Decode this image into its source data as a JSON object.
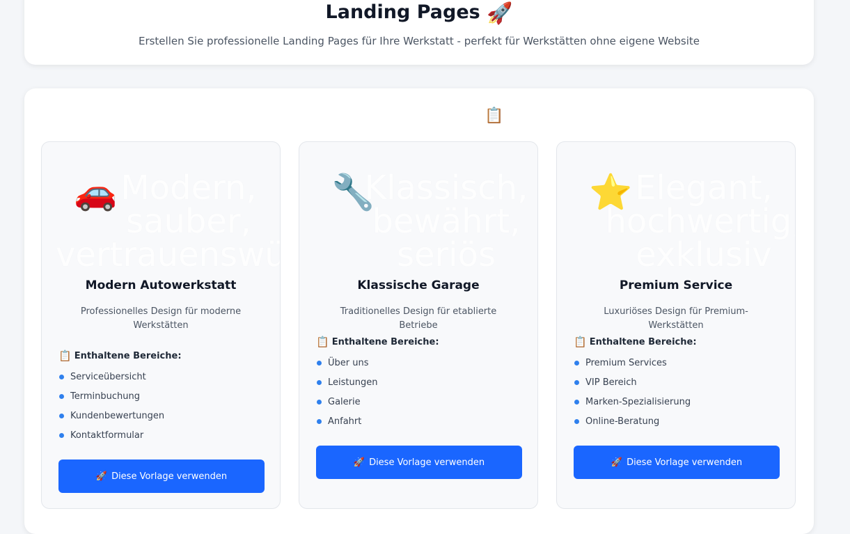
{
  "header": {
    "title": "Landing Pages",
    "title_emoji": "🚀",
    "subtitle": "Erstellen Sie professionelle Landing Pages für Ihre Werkstatt - perfekt für Werkstätten ohne eigene Website"
  },
  "section": {
    "icon": "📋"
  },
  "templates": [
    {
      "emoji": "🚗",
      "preview_text": "Modern,\nsauber,\nvertrauenswürdig",
      "title": "Modern Autowerkstatt",
      "description": "Professionelles Design für moderne Werkstätten",
      "includes_icon": "📋",
      "includes_label": "Enthaltene Bereiche:",
      "features": [
        "Serviceübersicht",
        "Terminbuchung",
        "Kundenbewertungen",
        "Kontaktformular"
      ],
      "button_icon": "🚀",
      "button_label": "Diese Vorlage verwenden"
    },
    {
      "emoji": "🔧",
      "preview_text": "Klassisch,\nbewährt,\nseriös",
      "title": "Klassische Garage",
      "description": "Traditionelles Design für etablierte Betriebe",
      "includes_icon": "📋",
      "includes_label": "Enthaltene Bereiche:",
      "features": [
        "Über uns",
        "Leistungen",
        "Galerie",
        "Anfahrt"
      ],
      "button_icon": "🚀",
      "button_label": "Diese Vorlage verwenden"
    },
    {
      "emoji": "⭐",
      "preview_text": "Elegant,\nhochwertig,\nexklusiv",
      "title": "Premium Service",
      "description": "Luxuriöses Design für Premium-Werkstätten",
      "includes_icon": "📋",
      "includes_label": "Enthaltene Bereiche:",
      "features": [
        "Premium Services",
        "VIP Bereich",
        "Marken-Spezialisierung",
        "Online-Beratung"
      ],
      "button_icon": "🚀",
      "button_label": "Diese Vorlage verwenden"
    }
  ],
  "colors": {
    "primary_button": "#1a66ff",
    "bullet": "#2f80ed",
    "page_background": "#f4f6f9"
  }
}
